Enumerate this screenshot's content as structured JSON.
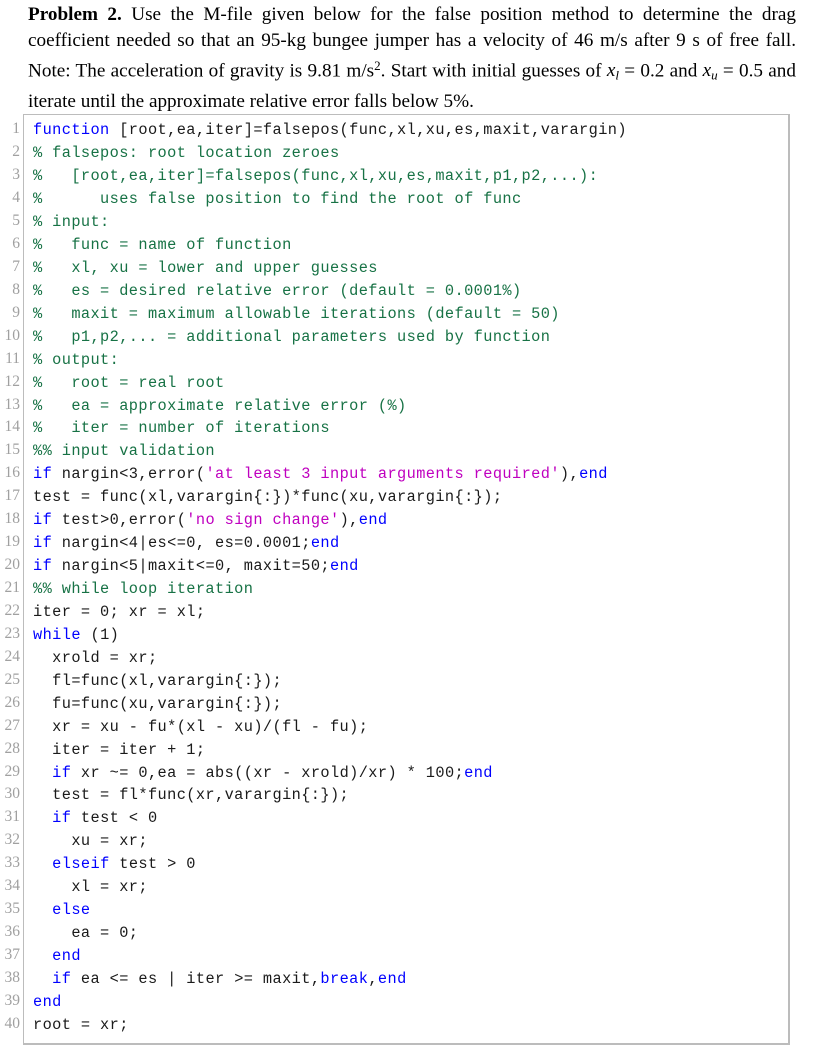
{
  "problem": {
    "label": "Problem 2.",
    "sentence_1_a": " Use the M-file given below for the false position method to determine the drag coefficient needed so that an 95-kg bungee jumper has a velocity of 46 m/s after 9 s of free fall. Note: The acceleration of gravity is 9.81 m/s",
    "sentence_1_sup": "2",
    "sentence_1_b": ". Start with initial guesses of ",
    "var_xl": "x",
    "var_xl_sub": "l",
    "mid_1": " = 0.2 and ",
    "var_xu": "x",
    "var_xu_sub": "u",
    "mid_2": " = 0.5 and iterate until the approximate relative error falls below 5%."
  },
  "colors": {
    "keyword": "#0000ff",
    "comment": "#177245",
    "string": "#bf00bf",
    "text": "#1a1a1a",
    "line_number": "#a0a0a0",
    "frame_border": "#bcbcbc",
    "background": "#ffffff"
  },
  "code": {
    "language": "MATLAB",
    "first_line_number": 1,
    "total_lines": 40,
    "lines": [
      {
        "n": 1,
        "tokens": [
          {
            "t": "kw",
            "s": "function"
          },
          {
            "t": "txt",
            "s": " [root,ea,iter]=falsepos(func,xl,xu,es,maxit,varargin)"
          }
        ]
      },
      {
        "n": 2,
        "tokens": [
          {
            "t": "com",
            "s": "% falsepos: root location zeroes"
          }
        ]
      },
      {
        "n": 3,
        "tokens": [
          {
            "t": "com",
            "s": "%   [root,ea,iter]=falsepos(func,xl,xu,es,maxit,p1,p2,...):"
          }
        ]
      },
      {
        "n": 4,
        "tokens": [
          {
            "t": "com",
            "s": "%      uses false position to find the root of func"
          }
        ]
      },
      {
        "n": 5,
        "tokens": [
          {
            "t": "com",
            "s": "% input:"
          }
        ]
      },
      {
        "n": 6,
        "tokens": [
          {
            "t": "com",
            "s": "%   func = name of function"
          }
        ]
      },
      {
        "n": 7,
        "tokens": [
          {
            "t": "com",
            "s": "%   xl, xu = lower and upper guesses"
          }
        ]
      },
      {
        "n": 8,
        "tokens": [
          {
            "t": "com",
            "s": "%   es = desired relative error (default = 0.0001%)"
          }
        ]
      },
      {
        "n": 9,
        "tokens": [
          {
            "t": "com",
            "s": "%   maxit = maximum allowable iterations (default = 50)"
          }
        ]
      },
      {
        "n": 10,
        "tokens": [
          {
            "t": "com",
            "s": "%   p1,p2,... = additional parameters used by function"
          }
        ]
      },
      {
        "n": 11,
        "tokens": [
          {
            "t": "com",
            "s": "% output:"
          }
        ]
      },
      {
        "n": 12,
        "tokens": [
          {
            "t": "com",
            "s": "%   root = real root"
          }
        ]
      },
      {
        "n": 13,
        "tokens": [
          {
            "t": "com",
            "s": "%   ea = approximate relative error (%)"
          }
        ]
      },
      {
        "n": 14,
        "tokens": [
          {
            "t": "com",
            "s": "%   iter = number of iterations"
          }
        ]
      },
      {
        "n": 15,
        "tokens": [
          {
            "t": "com",
            "s": "%% input validation"
          }
        ]
      },
      {
        "n": 16,
        "tokens": [
          {
            "t": "kw",
            "s": "if"
          },
          {
            "t": "txt",
            "s": " nargin<3,error("
          },
          {
            "t": "str",
            "s": "'at least 3 input arguments required'"
          },
          {
            "t": "txt",
            "s": "),"
          },
          {
            "t": "kw",
            "s": "end"
          }
        ]
      },
      {
        "n": 17,
        "tokens": [
          {
            "t": "txt",
            "s": "test = func(xl,varargin{:})*func(xu,varargin{:});"
          }
        ]
      },
      {
        "n": 18,
        "tokens": [
          {
            "t": "kw",
            "s": "if"
          },
          {
            "t": "txt",
            "s": " test>0,error("
          },
          {
            "t": "str",
            "s": "'no sign change'"
          },
          {
            "t": "txt",
            "s": "),"
          },
          {
            "t": "kw",
            "s": "end"
          }
        ]
      },
      {
        "n": 19,
        "tokens": [
          {
            "t": "kw",
            "s": "if"
          },
          {
            "t": "txt",
            "s": " nargin<4|es<=0, es=0.0001;"
          },
          {
            "t": "kw",
            "s": "end"
          }
        ]
      },
      {
        "n": 20,
        "tokens": [
          {
            "t": "kw",
            "s": "if"
          },
          {
            "t": "txt",
            "s": " nargin<5|maxit<=0, maxit=50;"
          },
          {
            "t": "kw",
            "s": "end"
          }
        ]
      },
      {
        "n": 21,
        "tokens": [
          {
            "t": "com",
            "s": "%% while loop iteration"
          }
        ]
      },
      {
        "n": 22,
        "tokens": [
          {
            "t": "txt",
            "s": "iter = 0; xr = xl;"
          }
        ]
      },
      {
        "n": 23,
        "tokens": [
          {
            "t": "kw",
            "s": "while"
          },
          {
            "t": "txt",
            "s": " (1)"
          }
        ]
      },
      {
        "n": 24,
        "tokens": [
          {
            "t": "txt",
            "s": "  xrold = xr;"
          }
        ]
      },
      {
        "n": 25,
        "tokens": [
          {
            "t": "txt",
            "s": "  fl=func(xl,varargin{:});"
          }
        ]
      },
      {
        "n": 26,
        "tokens": [
          {
            "t": "txt",
            "s": "  fu=func(xu,varargin{:});"
          }
        ]
      },
      {
        "n": 27,
        "tokens": [
          {
            "t": "txt",
            "s": "  xr = xu - fu*(xl - xu)/(fl - fu);"
          }
        ]
      },
      {
        "n": 28,
        "tokens": [
          {
            "t": "txt",
            "s": "  iter = iter + 1;"
          }
        ]
      },
      {
        "n": 29,
        "tokens": [
          {
            "t": "txt",
            "s": "  "
          },
          {
            "t": "kw",
            "s": "if"
          },
          {
            "t": "txt",
            "s": " xr ~= 0,ea = abs((xr - xrold)/xr) * 100;"
          },
          {
            "t": "kw",
            "s": "end"
          }
        ]
      },
      {
        "n": 30,
        "tokens": [
          {
            "t": "txt",
            "s": "  test = fl*func(xr,varargin{:});"
          }
        ]
      },
      {
        "n": 31,
        "tokens": [
          {
            "t": "txt",
            "s": "  "
          },
          {
            "t": "kw",
            "s": "if"
          },
          {
            "t": "txt",
            "s": " test < 0"
          }
        ]
      },
      {
        "n": 32,
        "tokens": [
          {
            "t": "txt",
            "s": "    xu = xr;"
          }
        ]
      },
      {
        "n": 33,
        "tokens": [
          {
            "t": "txt",
            "s": "  "
          },
          {
            "t": "kw",
            "s": "elseif"
          },
          {
            "t": "txt",
            "s": " test > 0"
          }
        ]
      },
      {
        "n": 34,
        "tokens": [
          {
            "t": "txt",
            "s": "    xl = xr;"
          }
        ]
      },
      {
        "n": 35,
        "tokens": [
          {
            "t": "txt",
            "s": "  "
          },
          {
            "t": "kw",
            "s": "else"
          }
        ]
      },
      {
        "n": 36,
        "tokens": [
          {
            "t": "txt",
            "s": "    ea = 0;"
          }
        ]
      },
      {
        "n": 37,
        "tokens": [
          {
            "t": "txt",
            "s": "  "
          },
          {
            "t": "kw",
            "s": "end"
          }
        ]
      },
      {
        "n": 38,
        "tokens": [
          {
            "t": "txt",
            "s": "  "
          },
          {
            "t": "kw",
            "s": "if"
          },
          {
            "t": "txt",
            "s": " ea <= es | iter >= maxit,"
          },
          {
            "t": "kw",
            "s": "break"
          },
          {
            "t": "txt",
            "s": ","
          },
          {
            "t": "kw",
            "s": "end"
          }
        ]
      },
      {
        "n": 39,
        "tokens": [
          {
            "t": "kw",
            "s": "end"
          }
        ]
      },
      {
        "n": 40,
        "tokens": [
          {
            "t": "txt",
            "s": "root = xr;"
          }
        ]
      }
    ]
  }
}
